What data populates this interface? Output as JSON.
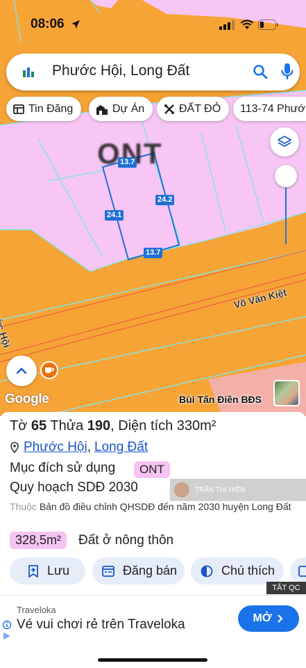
{
  "status": {
    "time": "08:06"
  },
  "search": {
    "query": "Phước Hội, Long Đất"
  },
  "chips": [
    {
      "label": "Tin Đăng",
      "icon": "newspaper-icon"
    },
    {
      "label": "Dự Án",
      "icon": "buildings-icon"
    },
    {
      "label": "ĐẤT ĐỎ",
      "icon": "tools-icon"
    },
    {
      "label": "113-74 Phướ",
      "icon": ""
    }
  ],
  "map": {
    "zone_label": "ONT",
    "dimensions": {
      "top": "13.7",
      "bottom": "13.7",
      "left": "24.1",
      "right": "24.2"
    },
    "road_labels": {
      "vo_van_kiet": "Võ Văn Kiệt",
      "phuoc_hoi": "Phước Hội"
    },
    "watermark": "Google",
    "author": "Bùi Tấn Điền BĐS"
  },
  "parcel": {
    "sheet_label": "Tờ",
    "sheet_no": "65",
    "lot_label": "Thửa",
    "lot_no": "190",
    "area_label": "Diện tích",
    "area_value": "330m²",
    "ward": "Phước Hội",
    "district": "Long Đất",
    "purpose_label": "Mục đích sử dụng",
    "purpose_tag": "ONT",
    "plan_label": "Quy hoạch SDĐ 2030",
    "note_prefix": "Thuộc",
    "note_text": "Bản đồ điều chỉnh QHSDĐ đến năm 2030 huyện Long Đất",
    "plan_area": "328,5m²",
    "plan_type": "Đất ở nông thôn",
    "overlay_name": "TRẦN THỊ HIỀN"
  },
  "actions": [
    {
      "label": "Lưu",
      "icon": "bookmark-plus-icon"
    },
    {
      "label": "Đăng bán",
      "icon": "listing-icon"
    },
    {
      "label": "Chú thích",
      "icon": "contrast-icon"
    }
  ],
  "ad": {
    "close_label": "TẮT QC",
    "brand": "Traveloka",
    "headline": "Vé vui chơi rẻ trên Traveloka",
    "cta": "MỞ"
  },
  "colors": {
    "accent": "#1a73e8",
    "zone_pink": "#f5c4f2",
    "map_orange": "#f7a437"
  }
}
